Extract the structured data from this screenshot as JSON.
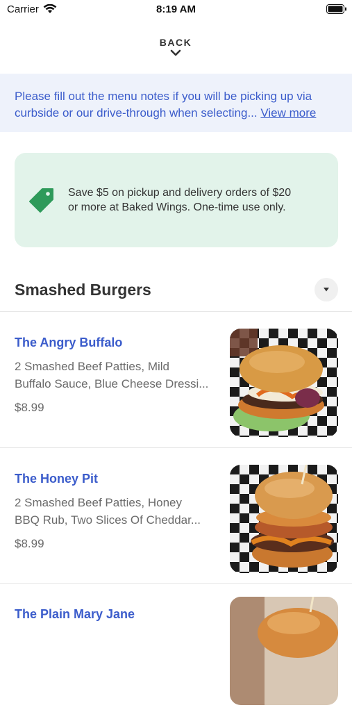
{
  "status_bar": {
    "carrier": "Carrier",
    "time": "8:19 AM"
  },
  "header": {
    "back_label": "BACK"
  },
  "notice": {
    "line1": "Please fill out the menu notes if you will be picking up via",
    "line2": "curbside or our drive-through when selecting...",
    "view_more": "View more"
  },
  "promo": {
    "icon": "tag-icon",
    "line1": "Save $5 on pickup and delivery orders of $20",
    "line2": "or more at Baked Wings. One-time use only."
  },
  "section": {
    "title": "Smashed Burgers"
  },
  "colors": {
    "accent": "#3b5ccb",
    "promo_bg": "#e2f3ea",
    "notice_bg": "#eef2fb",
    "tag_green": "#2e9a5a"
  },
  "menu_items": [
    {
      "name": "The Angry Buffalo",
      "desc_line1": "2 Smashed Beef Patties, Mild",
      "desc_line2": "Buffalo Sauce, Blue Cheese Dressi...",
      "price": "$8.99"
    },
    {
      "name": "The Honey Pit",
      "desc_line1": "2 Smashed Beef Patties, Honey",
      "desc_line2": "BBQ Rub, Two Slices Of Cheddar...",
      "price": "$8.99"
    },
    {
      "name": "The Plain Mary Jane",
      "desc_line1": "",
      "desc_line2": "",
      "price": ""
    }
  ]
}
